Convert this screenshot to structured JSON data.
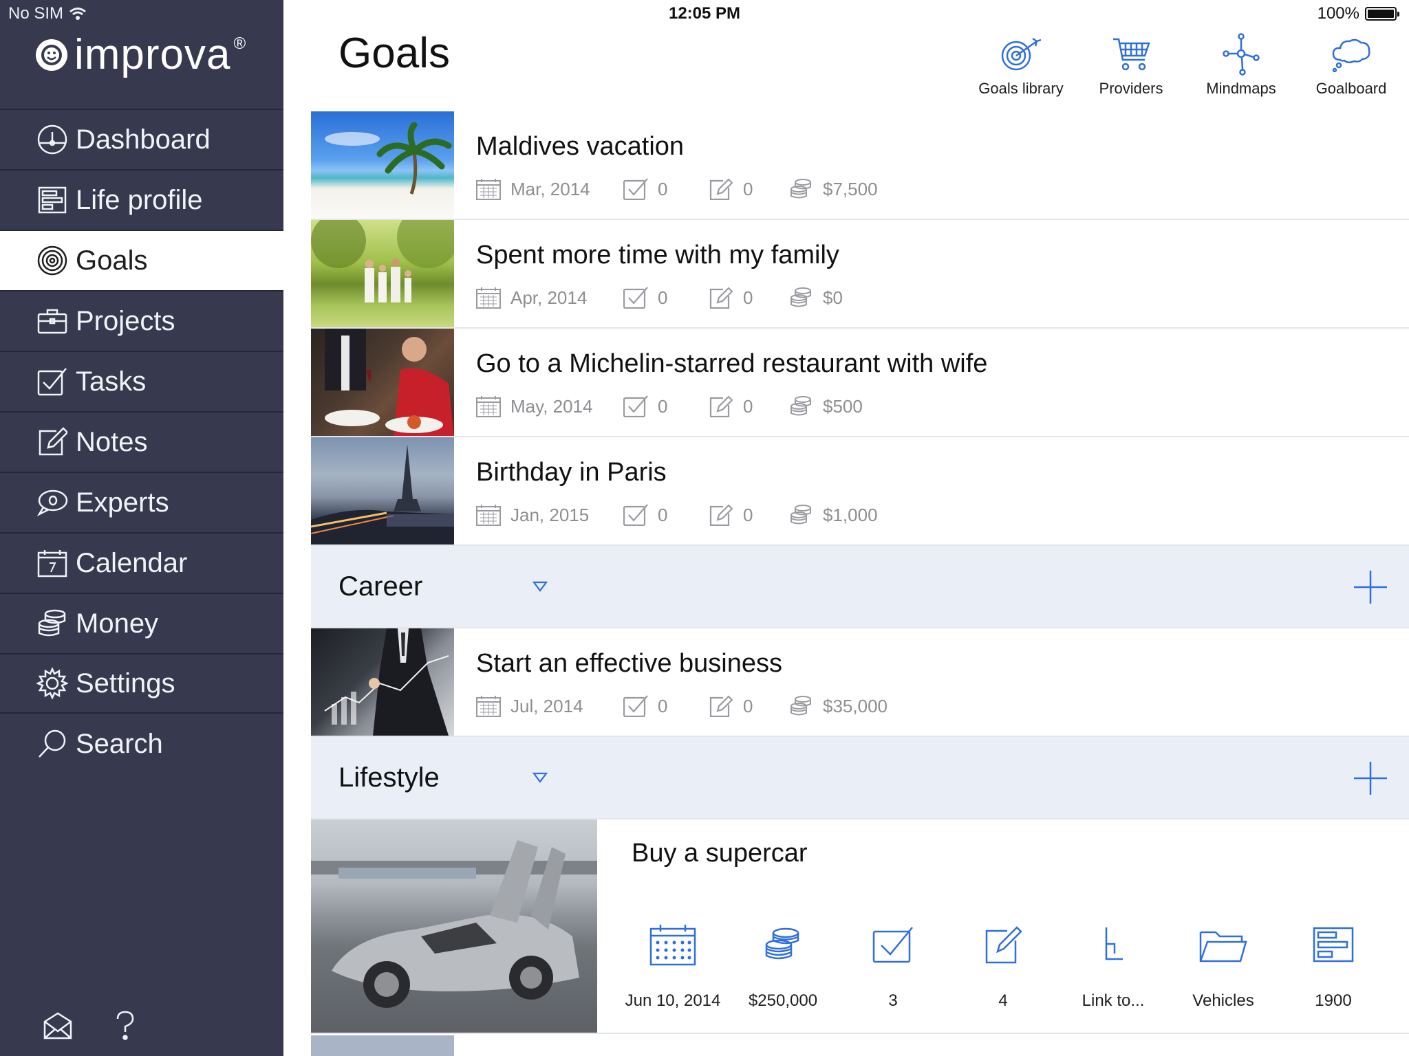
{
  "status_bar": {
    "carrier": "No SIM",
    "time": "12:05 PM",
    "battery": "100%"
  },
  "app": {
    "brand": "improva",
    "registered": "®"
  },
  "sidebar": {
    "items": [
      {
        "label": "Dashboard",
        "icon": "dashboard-icon"
      },
      {
        "label": "Life profile",
        "icon": "life-profile-icon"
      },
      {
        "label": "Goals",
        "icon": "goals-target-icon",
        "active": true
      },
      {
        "label": "Projects",
        "icon": "briefcase-icon"
      },
      {
        "label": "Tasks",
        "icon": "checkbox-icon"
      },
      {
        "label": "Notes",
        "icon": "note-edit-icon"
      },
      {
        "label": "Experts",
        "icon": "chat-bubble-icon"
      },
      {
        "label": "Calendar",
        "icon": "calendar-icon"
      },
      {
        "label": "Money",
        "icon": "coins-icon"
      },
      {
        "label": "Settings",
        "icon": "gear-icon"
      },
      {
        "label": "Search",
        "icon": "search-icon"
      }
    ],
    "footer": {
      "mail_icon": "mail-icon",
      "help_icon": "help-icon"
    }
  },
  "header": {
    "title": "Goals",
    "tools": [
      {
        "label": "Goals library",
        "icon": "target-arrow-icon"
      },
      {
        "label": "Providers",
        "icon": "cart-icon"
      },
      {
        "label": "Mindmaps",
        "icon": "mindmap-icon"
      },
      {
        "label": "Goalboard",
        "icon": "cloud-icon"
      }
    ]
  },
  "goals": [
    {
      "title": "Maldives vacation",
      "date": "Mar, 2014",
      "tasks": "0",
      "notes": "0",
      "money": "$7,500",
      "image": "beach-palm-photo"
    },
    {
      "title": "Spent more time with my family",
      "date": "Apr, 2014",
      "tasks": "0",
      "notes": "0",
      "money": "$0",
      "image": "family-park-photo"
    },
    {
      "title": "Go to a Michelin-starred restaurant with wife",
      "date": "May, 2014",
      "tasks": "0",
      "notes": "0",
      "money": "$500",
      "image": "restaurant-couple-photo"
    },
    {
      "title": "Birthday in Paris",
      "date": "Jan, 2015",
      "tasks": "0",
      "notes": "0",
      "money": "$1,000",
      "image": "paris-eiffel-photo"
    }
  ],
  "categories": [
    {
      "title": "Career",
      "goals": [
        {
          "title": "Start an effective business",
          "date": "Jul, 2014",
          "tasks": "0",
          "notes": "0",
          "money": "$35,000",
          "image": "business-chart-photo"
        }
      ]
    },
    {
      "title": "Lifestyle",
      "expanded_goal": {
        "title": "Buy a supercar",
        "image": "supercar-photo",
        "details": [
          {
            "label": "Jun 10, 2014",
            "icon": "calendar-icon"
          },
          {
            "label": "$250,000",
            "icon": "coins-icon"
          },
          {
            "label": "3",
            "icon": "checkbox-icon"
          },
          {
            "label": "4",
            "icon": "note-edit-icon"
          },
          {
            "label": "Link to...",
            "icon": "link-icon"
          },
          {
            "label": "Vehicles",
            "icon": "folder-icon"
          },
          {
            "label": "1900",
            "icon": "life-profile-icon"
          }
        ]
      }
    }
  ],
  "colors": {
    "sidebar": "#373a4f",
    "accent": "#2f6fdc",
    "category_bg": "#e9eef7",
    "meta_text": "#8e8e92"
  }
}
